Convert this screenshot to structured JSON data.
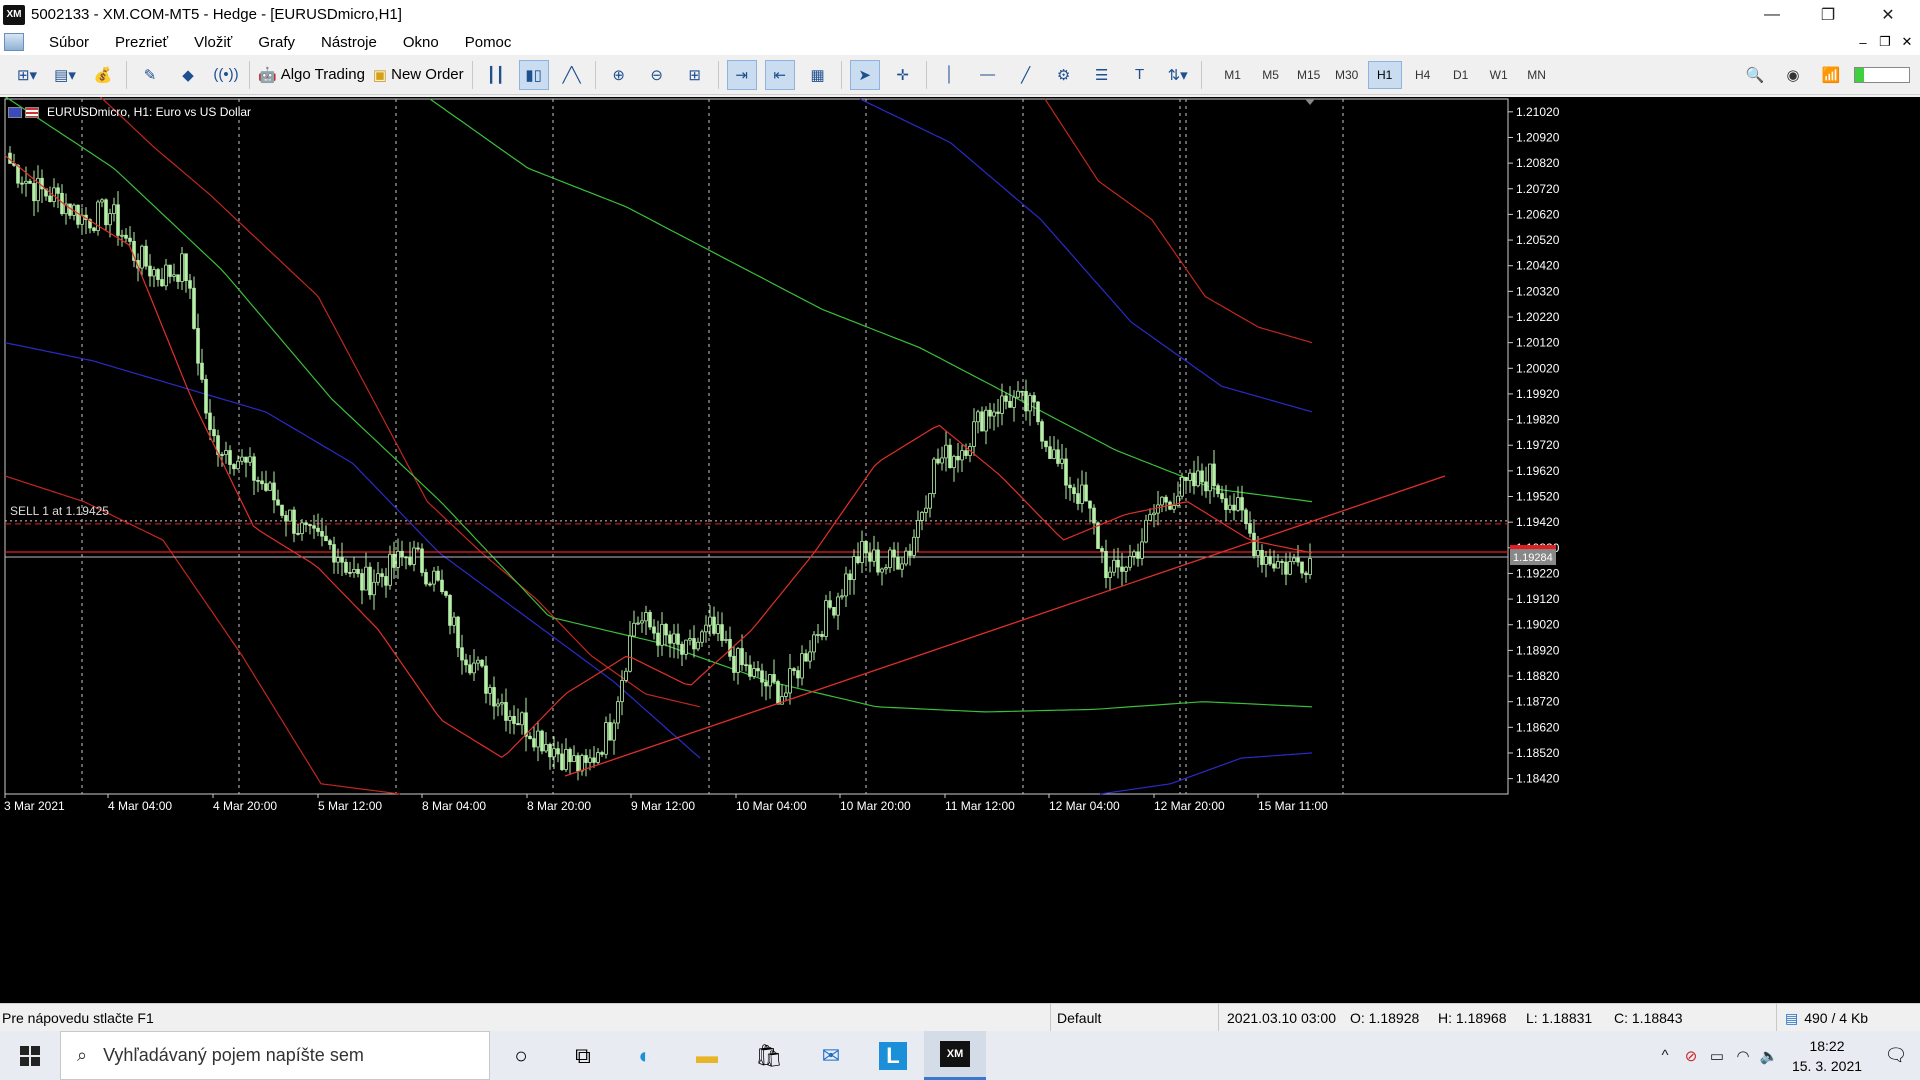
{
  "window": {
    "title": "5002133 - XM.COM-MT5 - Hedge - [EURUSDmicro,H1]",
    "logo": "XM",
    "controls": {
      "minimize": "—",
      "restore": "❐",
      "close": "✕"
    }
  },
  "menu": {
    "items": [
      "Súbor",
      "Prezrieť",
      "Vložiť",
      "Grafy",
      "Nástroje",
      "Okno",
      "Pomoc"
    ],
    "mdi": {
      "minimize": "–",
      "restore": "❐",
      "close": "✕"
    }
  },
  "toolbar": {
    "algo_trading": "Algo Trading",
    "new_order": "New Order",
    "timeframes": [
      "M1",
      "M5",
      "M15",
      "M30",
      "H1",
      "H4",
      "D1",
      "W1",
      "MN"
    ],
    "active_timeframe": "H1",
    "accent": "#1e4f8f"
  },
  "chart": {
    "title": "EURUSDmicro, H1:  Euro vs US Dollar",
    "order_line_label": "SELL 1 at 1.19425",
    "bid_label": "1.19284",
    "colors": {
      "background": "#000000",
      "bull": "#b6f0a8",
      "bear": "#b6f0a8",
      "grid": "#c8c8c8",
      "ma_fast": "#e0302a",
      "ma_slow": "#3bbf3b",
      "bb_upper": "#c0281f",
      "bb_mid": "#2b2bc8",
      "trendline": "#e0302a",
      "bid_line": "#e02020",
      "order_line": "#c8c8c8"
    }
  },
  "chart_data": {
    "type": "candlestick",
    "symbol": "EURUSDmicro",
    "timeframe": "H1",
    "y_ticks": [
      "1.21020",
      "1.20920",
      "1.20820",
      "1.20720",
      "1.20620",
      "1.20520",
      "1.20420",
      "1.20320",
      "1.20220",
      "1.20120",
      "1.20020",
      "1.19920",
      "1.19820",
      "1.19720",
      "1.19620",
      "1.19520",
      "1.19420",
      "1.19320",
      "1.19220",
      "1.19120",
      "1.19020",
      "1.18920",
      "1.18820",
      "1.18720",
      "1.18620",
      "1.18520",
      "1.18420"
    ],
    "ylim": [
      1.1836,
      1.2107
    ],
    "x_ticks": [
      "3 Mar 2021",
      "4 Mar 04:00",
      "4 Mar 20:00",
      "5 Mar 12:00",
      "8 Mar 04:00",
      "8 Mar 20:00",
      "9 Mar 12:00",
      "10 Mar 04:00",
      "10 Mar 20:00",
      "11 Mar 12:00",
      "12 Mar 04:00",
      "12 Mar 20:00",
      "15 Mar 11:00"
    ],
    "order_price": 1.19425,
    "bid_price": 1.19284,
    "close_anchors": [
      1.2082,
      1.2072,
      1.2068,
      1.206,
      1.2063,
      1.2046,
      1.2038,
      1.2042,
      1.1975,
      1.1968,
      1.1958,
      1.1946,
      1.1935,
      1.1932,
      1.1918,
      1.1922,
      1.193,
      1.192,
      1.1895,
      1.188,
      1.1868,
      1.186,
      1.1852,
      1.1845,
      1.1862,
      1.1905,
      1.1898,
      1.189,
      1.19,
      1.1888,
      1.188,
      1.1875,
      1.1895,
      1.1912,
      1.193,
      1.1925,
      1.1932,
      1.1965,
      1.197,
      1.1985,
      1.199,
      1.1985,
      1.1962,
      1.195,
      1.192,
      1.193,
      1.195,
      1.1955,
      1.196,
      1.1948,
      1.193,
      1.1925,
      1.1928
    ],
    "candle_count": 326,
    "indicators": {
      "ma_fast_anchors": [
        1.2085,
        1.2065,
        1.205,
        1.199,
        1.194,
        1.1925,
        1.19,
        1.1865,
        1.185,
        1.1875,
        1.189,
        1.1878,
        1.19,
        1.193,
        1.1965,
        1.198,
        1.196,
        1.1935,
        1.1945,
        1.195,
        1.1935,
        1.193
      ],
      "ma_slow_anchors": [
        1.2108,
        1.208,
        1.204,
        1.199,
        1.195,
        1.1905,
        1.1895,
        1.188,
        1.187,
        1.1868,
        1.1869,
        1.1872,
        1.187
      ],
      "envelope_upper_anchors": [
        1.2108,
        1.2088,
        1.207,
        1.205,
        1.203,
        1.199,
        1.195,
        1.193,
        1.1912,
        1.189,
        1.1875,
        1.187
      ],
      "envelope_upper_right_anchors": [
        1.2107,
        1.2075,
        1.206,
        1.203,
        1.2018,
        1.2012
      ],
      "green_upper_anchors": [
        1.2107,
        1.208,
        1.2065,
        1.2045,
        1.2025,
        1.201,
        1.199,
        1.197,
        1.1955,
        1.195
      ],
      "blue_line_anchors": [
        1.2012,
        1.2005,
        1.1995,
        1.1985,
        1.1965,
        1.193,
        1.1905,
        1.188,
        1.185
      ],
      "blue_right_anchors": [
        1.2107,
        1.209,
        1.206,
        1.202,
        1.1995,
        1.1985
      ],
      "blue_low_anchors": [
        1.1836,
        1.184,
        1.185,
        1.1852
      ],
      "red_low_anchors": [
        1.196,
        1.195,
        1.1935,
        1.189,
        1.184,
        1.1836
      ],
      "trendline": {
        "from": 1.1843,
        "to": 1.196
      }
    }
  },
  "status": {
    "help": "Pre nápovedu stlačte F1",
    "profile": "Default",
    "datetime": "2021.03.10 03:00",
    "open": "O: 1.18928",
    "high": "H: 1.18968",
    "low": "L: 1.18831",
    "close": "C: 1.18843",
    "traffic": "490 / 4 Kb"
  },
  "taskbar": {
    "search_placeholder": "Vyhľadávaný pojem napíšte sem",
    "time": "18:22",
    "date": "15. 3. 2021"
  }
}
